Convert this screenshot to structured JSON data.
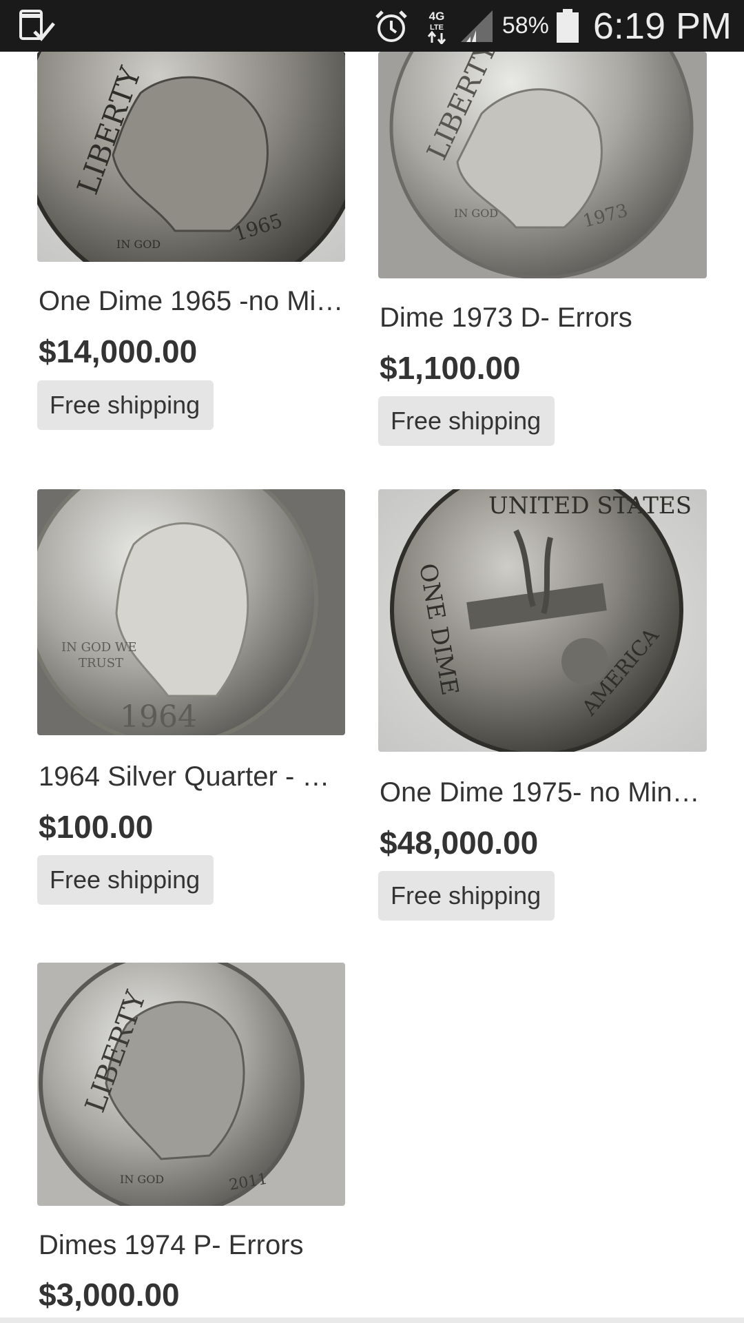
{
  "status_bar": {
    "battery_text": "58%",
    "time": "6:19 PM",
    "icons": [
      "download-notification-icon",
      "alarm-icon",
      "4g-lte-icon",
      "signal-icon",
      "battery-icon"
    ]
  },
  "products": [
    {
      "title": "One Dime 1965 -no Mi…",
      "price": "$14,000.00",
      "shipping": "Free shipping",
      "image": "dime-1965-obverse"
    },
    {
      "title": "Dime 1973 D- Errors",
      "price": "$1,100.00",
      "shipping": "Free shipping",
      "image": "dime-1973-obverse"
    },
    {
      "title": "1964 Silver Quarter - …",
      "price": "$100.00",
      "shipping": "Free shipping",
      "image": "quarter-1964-obverse"
    },
    {
      "title": "One Dime 1975- no Min…",
      "price": "$48,000.00",
      "shipping": "Free shipping",
      "image": "dime-1975-reverse"
    },
    {
      "title": "Dimes 1974 P- Errors",
      "price": "$3,000.00",
      "image": "dime-1974-obverse"
    }
  ]
}
